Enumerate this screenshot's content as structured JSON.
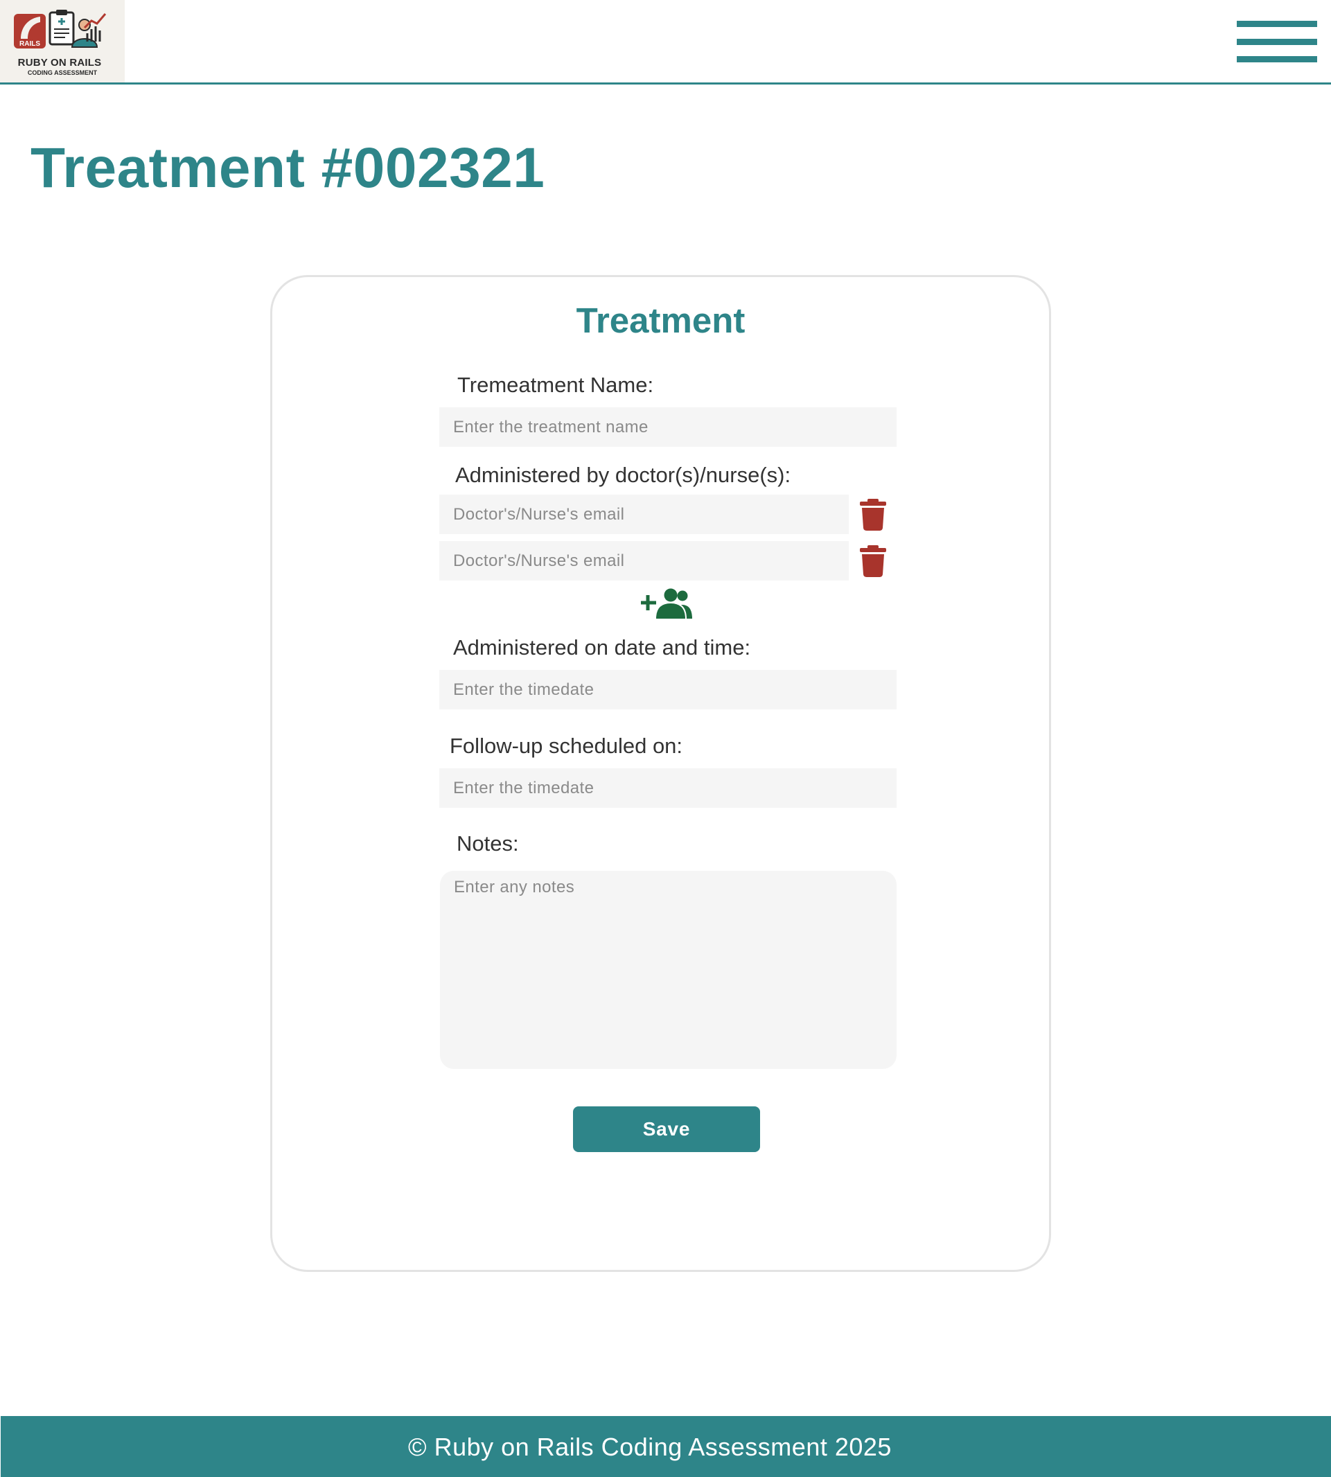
{
  "header": {
    "logo_title": "RUBY ON RAILS",
    "logo_subtitle": "CODING ASSESSMENT",
    "logo_badge": "RAILS",
    "menu_icon": "hamburger-menu-icon"
  },
  "page": {
    "title": "Treatment #002321"
  },
  "form": {
    "title": "Treatment",
    "name_label": "Tremeatment Name:",
    "name_placeholder": "Enter the treatment name",
    "staff_label": "Administered by doctor(s)/nurse(s):",
    "staff_emails": [
      {
        "placeholder": "Doctor's/Nurse's email",
        "value": ""
      },
      {
        "placeholder": "Doctor's/Nurse's email",
        "value": ""
      }
    ],
    "delete_icon": "trash-icon",
    "add_staff_icon": "add-users-icon",
    "administered_label": "Administered on date and time:",
    "administered_placeholder": "Enter the timedate",
    "followup_label": "Follow-up scheduled on:",
    "followup_placeholder": "Enter the timedate",
    "notes_label": "Notes:",
    "notes_placeholder": "Enter any notes",
    "save_label": "Save"
  },
  "footer": {
    "text": "© Ruby on Rails Coding Assessment 2025"
  },
  "colors": {
    "primary": "#2e8589",
    "danger": "#a8342c",
    "add_icon": "#1d6b3e",
    "input_bg": "#f5f5f5",
    "card_border": "#e3e3e3"
  }
}
